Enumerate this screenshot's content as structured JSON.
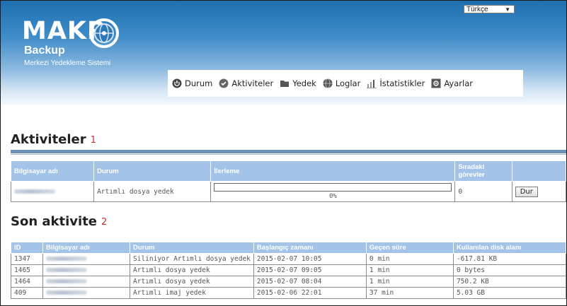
{
  "app": {
    "logo": "MAKR",
    "product": "Backup",
    "tagline": "Merkezi Yedekleme Sistemi"
  },
  "language": {
    "selected": "Türkçe"
  },
  "nav": [
    {
      "label": "Durum",
      "icon": "power-icon"
    },
    {
      "label": "Aktiviteler",
      "icon": "check-circle-icon"
    },
    {
      "label": "Yedek",
      "icon": "folder-icon"
    },
    {
      "label": "Loglar",
      "icon": "globe-icon"
    },
    {
      "label": "İstatistikler",
      "icon": "bar-chart-icon"
    },
    {
      "label": "Ayarlar",
      "icon": "settings-box-icon"
    }
  ],
  "activities": {
    "title": "Aktiviteler",
    "number": "1",
    "headers": [
      "Bilgisayar adı",
      "Durum",
      "İlerleme",
      "Sıradaki görevler",
      ""
    ],
    "row": {
      "status": "Artımlı dosya yedek",
      "progress": 0,
      "progress_text": "0%",
      "queued": "0",
      "stop_label": "Dur"
    }
  },
  "recent": {
    "title": "Son aktivite",
    "number": "2",
    "headers": [
      "ID",
      "Bilgisayar adı",
      "Durum",
      "Başlangıç zamanı",
      "Geçen süre",
      "Kullanılan disk alanı"
    ],
    "rows": [
      {
        "id": "1347",
        "status": "Siliniyor Artımlı dosya yedek",
        "start": "2015-02-07 10:05",
        "elapsed": "0 min",
        "disk": "-617.81 KB"
      },
      {
        "id": "1465",
        "status": "Artımlı dosya yedek",
        "start": "2015-02-07 09:05",
        "elapsed": "1 min",
        "disk": "0 bytes"
      },
      {
        "id": "1464",
        "status": "Artımlı dosya yedek",
        "start": "2015-02-07 08:04",
        "elapsed": "1 min",
        "disk": "750.2 KB"
      },
      {
        "id": "409",
        "status": "Artımlı imaj yedek",
        "start": "2015-02-06 22:01",
        "elapsed": "37 min",
        "disk": "5.03 GB"
      }
    ]
  },
  "colors": {
    "header_blue": "#1e6fb0",
    "table_header": "#a3c4e8",
    "accent_red": "#d03030"
  }
}
